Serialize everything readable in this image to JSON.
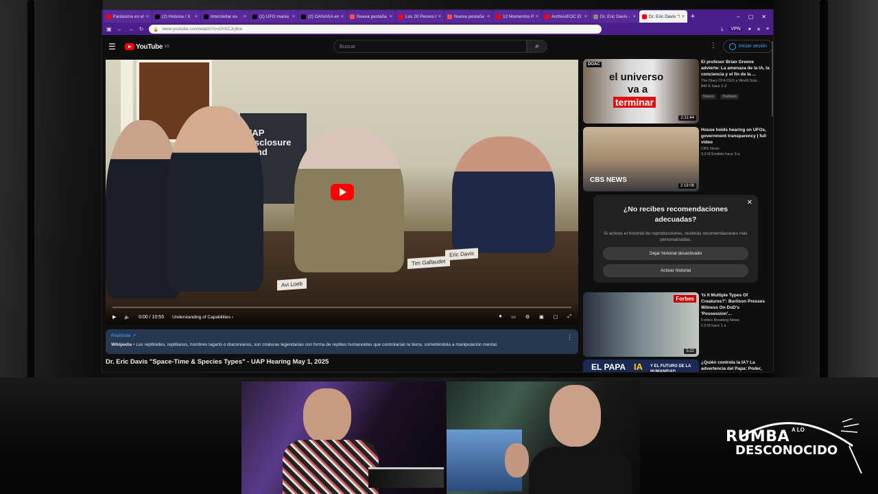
{
  "tabs": [
    {
      "label": "Fantasma en el tr",
      "fav": "#ff0000"
    },
    {
      "label": "(2) Historia / X",
      "fav": "#000000"
    },
    {
      "label": "Interstellar es",
      "fav": "#000000"
    },
    {
      "label": "(2) UFO mania e",
      "fav": "#000000"
    },
    {
      "label": "(2) OANASA en X",
      "fav": "#000000"
    },
    {
      "label": "Nueva pestaña",
      "fav": "#ff4a4a"
    },
    {
      "label": "Los 20 Peores Er",
      "fav": "#ff0000"
    },
    {
      "label": "Nueva pestaña",
      "fav": "#ff4a4a"
    },
    {
      "label": "12 Momentos Pe",
      "fav": "#ff0000"
    },
    {
      "label": "ArchivoEOC El Pe",
      "fav": "#ff0000"
    },
    {
      "label": "Dr. Eric Davis - B",
      "fav": "#888888"
    },
    {
      "label": "Dr. Eric Davis \"Sp",
      "fav": "#ff0000",
      "active": true
    }
  ],
  "browser": {
    "url": "www.youtube.com/watch?v=I2h5CJcjlkw",
    "vpn": "VPN"
  },
  "youtube": {
    "logo": "YouTube",
    "region": "ES",
    "search_placeholder": "Buscar",
    "signin": "Iniciar sesión"
  },
  "player": {
    "time": "0:00 / 10:55",
    "chapter": "Understanding of Capabilities",
    "banner": "UAP Disclosure Fund",
    "nameplates": [
      "Avi Loeb",
      "Tim Gallaudet",
      "Eric Davis"
    ]
  },
  "info": {
    "topic": "Reptiloide ↗",
    "source": "Wikipedia",
    "text": "Los reptiloides, reptilianos, hombres lagarto o draconianos, son criaturas legendarias con forma de reptiles humanoides que controlarían la tierra, sometiéndola a manipulación mental."
  },
  "video_title": "Dr. Eric Davis \"Space-Time & Species Types\" - UAP Hearing May 1, 2025",
  "recommendations": [
    {
      "title": "El profesor Brian Greene advierte: La amenaza de la IA, la conciencia y el fin de la ...",
      "channel": "The Diary Of A CEO y World Scie...",
      "stats": "846 K  hace 2 d",
      "badges": [
        "Nuevo",
        "Doblado"
      ],
      "duration": "2:11:44",
      "thumb_text1": "el universo",
      "thumb_text2": "va a",
      "thumb_text3": "terminar",
      "thumb_tag": "DOAC"
    },
    {
      "title": "House holds hearing on UFOs, government transparency | full video",
      "channel": "CBS News",
      "stats": "3,9 M  Emitido hace 3 a",
      "badges": [],
      "duration": "2:19:06",
      "thumb_text1": "CBS NEWS"
    },
    {
      "title": "'Is It Multiple Types Of Creatures?': Burlison Presses Witness On DoD's 'Possession'...",
      "channel": "Forbes Breaking News",
      "stats": "2,5 M  hace 1 a",
      "badges": [],
      "duration": "5:22",
      "thumb_text1": "Forbes"
    },
    {
      "title": "¿Quién controla la IA? La advertencia del Papa: Poder, verdad y libertad",
      "channel": "",
      "stats": "",
      "badges": [],
      "thumb_text1": "EL PAPA",
      "thumb_text2": "IA",
      "thumb_text3": "Y EL FUTURO DE LA HUMANIDAD"
    }
  ],
  "popup": {
    "title": "¿No recibes recomendaciones adecuadas?",
    "body": "Si activas el historial de reproducciones, recibirás recomendaciones más personalizadas.",
    "btn1": "Dejar historial desactivado",
    "btn2": "Activar historial"
  },
  "overlay_logo": {
    "line1": "RUMBA",
    "line2": "A LO",
    "line3": "DESCONOCIDO"
  }
}
